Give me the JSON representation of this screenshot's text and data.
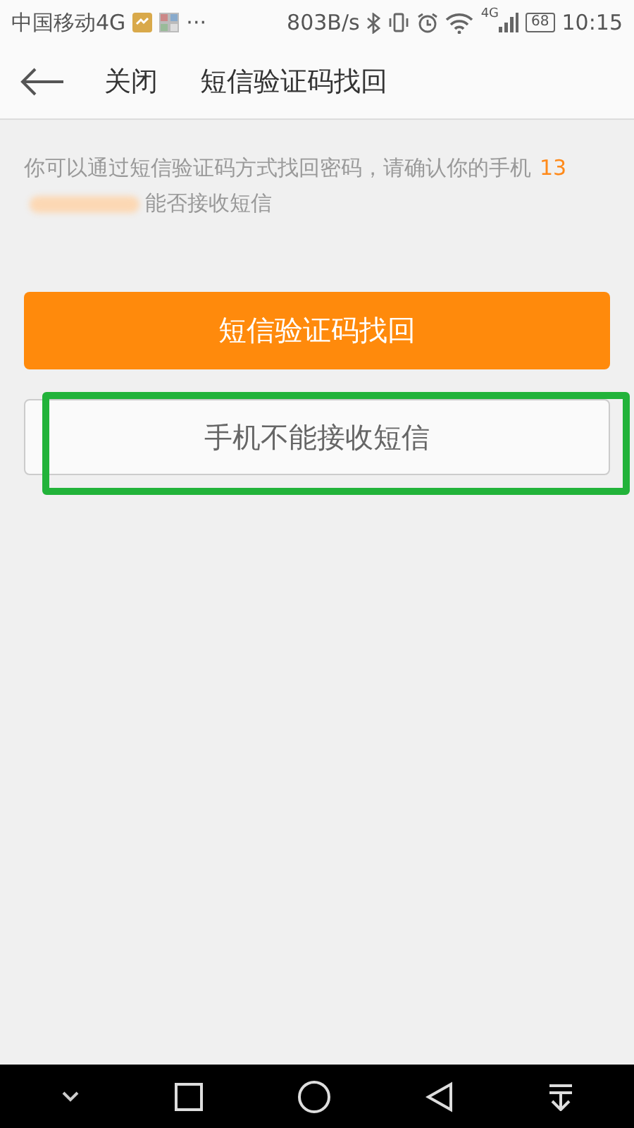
{
  "status_bar": {
    "carrier": "中国移动4G",
    "more": "···",
    "speed": "803B/s",
    "network": "4G",
    "battery": "68",
    "time": "10:15"
  },
  "header": {
    "close": "关闭",
    "title": "短信验证码找回"
  },
  "message": {
    "text": "你可以通过短信验证码方式找回密码，请确认你的手机",
    "phone": "13",
    "suffix": "能否接收短信"
  },
  "buttons": [
    {
      "label": "短信验证码找回",
      "kind": "primary",
      "highlighted": false
    },
    {
      "label": "手机不能接收短信",
      "kind": "secondary",
      "highlighted": true
    }
  ]
}
